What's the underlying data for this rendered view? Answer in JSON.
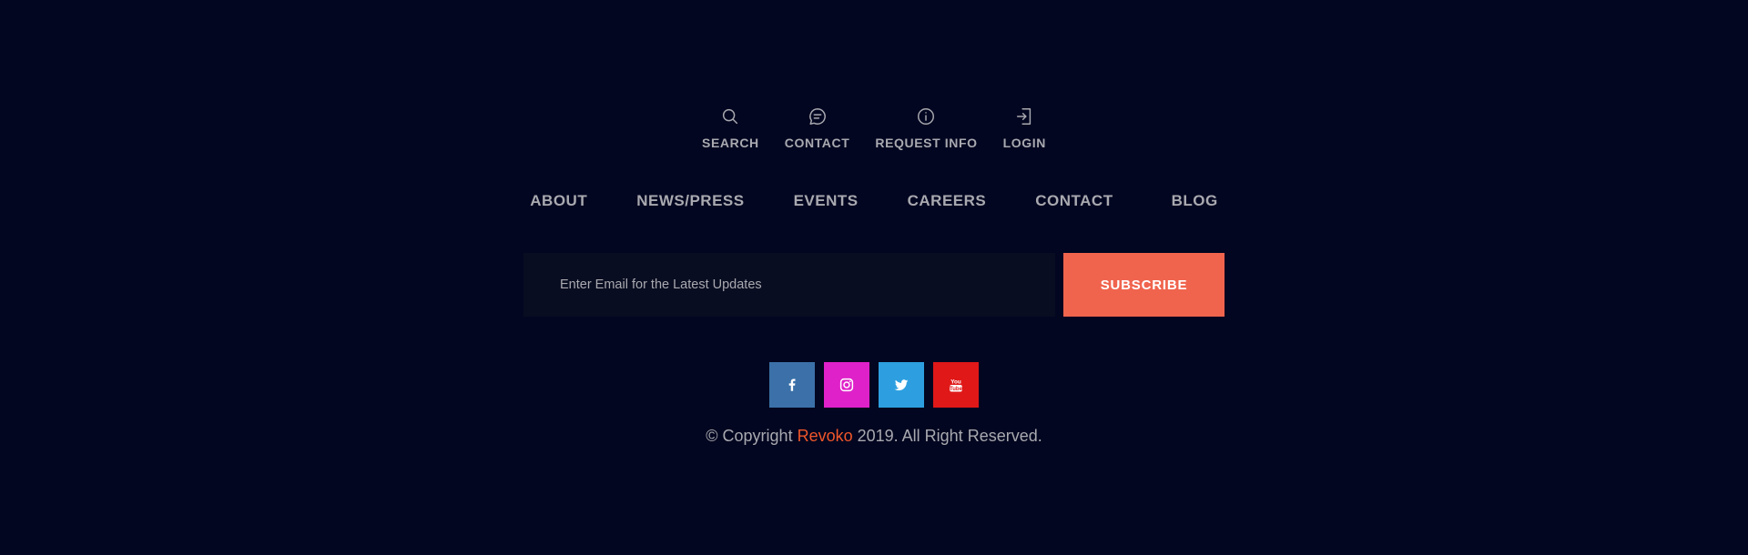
{
  "quick_links": [
    {
      "label": "SEARCH",
      "icon": "search-icon"
    },
    {
      "label": "CONTACT",
      "icon": "chat-bubble-icon"
    },
    {
      "label": "REQUEST INFO",
      "icon": "info-circle-icon"
    },
    {
      "label": "LOGIN",
      "icon": "login-icon"
    }
  ],
  "nav": [
    "ABOUT",
    "NEWS/PRESS",
    "EVENTS",
    "CAREERS",
    "CONTACT",
    "BLOG"
  ],
  "subscribe": {
    "placeholder": "Enter Email for the Latest Updates",
    "button_label": "SUBSCRIBE"
  },
  "social": [
    {
      "name": "facebook-icon",
      "color": "#3b71a8"
    },
    {
      "name": "instagram-icon",
      "color": "#df21c9"
    },
    {
      "name": "twitter-icon",
      "color": "#2d9fe0"
    },
    {
      "name": "youtube-icon",
      "color": "#e01818"
    }
  ],
  "copyright": {
    "prefix": "© Copyright ",
    "brand": "Revoko",
    "suffix": " 2019. All Right Reserved."
  },
  "colors": {
    "background": "#020620",
    "accent": "#f0644e",
    "brand_text": "#f0562a"
  }
}
